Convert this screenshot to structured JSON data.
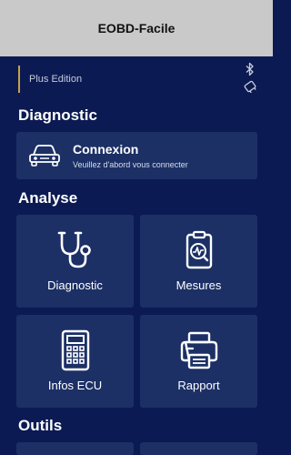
{
  "app": {
    "title": "EOBD-Facile"
  },
  "header": {
    "edition": "Plus Edition"
  },
  "sections": {
    "diagnostic": "Diagnostic",
    "analyse": "Analyse",
    "outils": "Outils"
  },
  "connexion": {
    "title": "Connexion",
    "subtitle": "Veuillez d'abord vous connecter"
  },
  "tiles": [
    {
      "label": "Diagnostic",
      "icon": "stethoscope-icon"
    },
    {
      "label": "Mesures",
      "icon": "clipboard-chart-icon"
    },
    {
      "label": "Infos ECU",
      "icon": "calculator-icon"
    },
    {
      "label": "Rapport",
      "icon": "printer-icon"
    }
  ],
  "colors": {
    "background": "#0b1a52",
    "card": "#1c3066",
    "titlebar": "#c9c9c9",
    "accent": "#c9a14a"
  }
}
